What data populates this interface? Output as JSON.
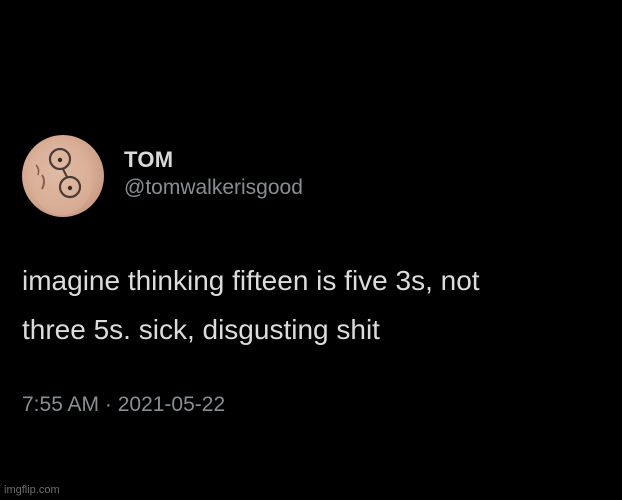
{
  "tweet": {
    "author": {
      "display_name": "TOM",
      "handle": "@tomwalkerisgood",
      "avatar_icon": "profile-photo-with-glasses"
    },
    "text_lines": [
      "imagine thinking fifteen is five 3s, not",
      "three 5s. sick, disgusting shit"
    ],
    "timestamp": "7:55 AM · 2021-05-22"
  },
  "watermark": {
    "text": "imgflip.com"
  },
  "colors": {
    "background": "#000000",
    "primary_text": "#dcdcdc",
    "secondary_text": "#8a8d91"
  }
}
